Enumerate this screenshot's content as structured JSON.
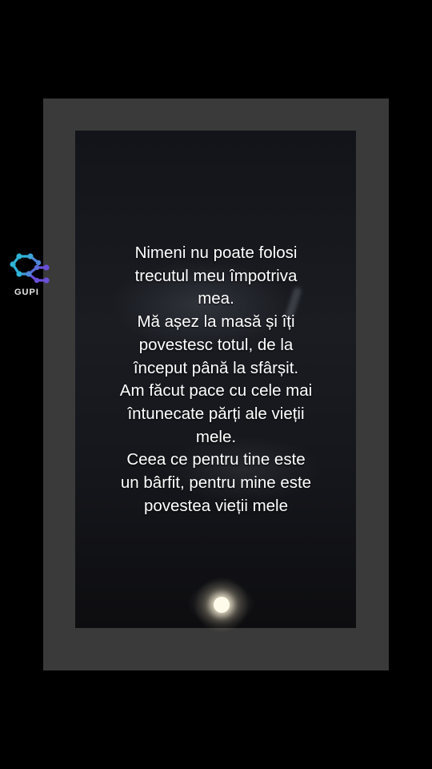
{
  "overlay": {
    "lines": [
      "Nimeni nu poate folosi",
      "trecutul meu împotriva",
      "mea.",
      "Mă așez la masă și îți",
      "povestesc totul, de la",
      "început până la sfârșit.",
      "Am făcut pace cu cele mai",
      "întunecate părți ale vieții",
      "mele.",
      "Ceea ce pentru tine este",
      "un bârfit, pentru mine este",
      "povestea vieții mele"
    ]
  },
  "watermark": {
    "label": "GUPI",
    "colors": [
      "#2fb3d6",
      "#6a4fd9"
    ]
  },
  "colors": {
    "background": "#000000",
    "frame": "#3a3a3a",
    "text": "#ffffff"
  }
}
